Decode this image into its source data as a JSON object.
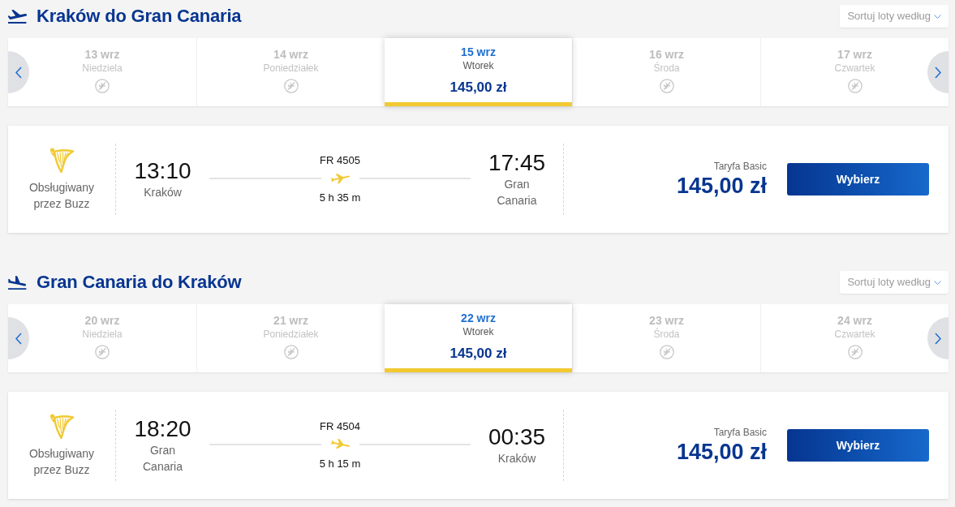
{
  "sections": [
    {
      "kind": "outbound",
      "title": "Kraków do Gran Canaria",
      "sort": {
        "label": "Sortuj loty według"
      },
      "dates": [
        {
          "date": "13 wrz",
          "weekday": "Niedziela",
          "selected": false
        },
        {
          "date": "14 wrz",
          "weekday": "Poniedziałek",
          "selected": false
        },
        {
          "date": "15 wrz",
          "weekday": "Wtorek",
          "price": "145,00 zł",
          "selected": true
        },
        {
          "date": "16 wrz",
          "weekday": "Środa",
          "selected": false
        },
        {
          "date": "17 wrz",
          "weekday": "Czwartek",
          "selected": false
        }
      ],
      "flights": [
        {
          "operator": "Obsługiwany przez Buzz",
          "departure_time": "13:10",
          "departure_city": "Kraków",
          "flight_number": "FR 4505",
          "duration": "5 h 35 m",
          "arrival_time": "17:45",
          "arrival_city": "Gran Canaria",
          "fare": "Taryfa Basic",
          "price": "145,00 zł",
          "button": "Wybierz"
        }
      ]
    },
    {
      "kind": "inbound",
      "title": "Gran Canaria do Kraków",
      "sort": {
        "label": "Sortuj loty według"
      },
      "dates": [
        {
          "date": "20 wrz",
          "weekday": "Niedziela",
          "selected": false
        },
        {
          "date": "21 wrz",
          "weekday": "Poniedziałek",
          "selected": false
        },
        {
          "date": "22 wrz",
          "weekday": "Wtorek",
          "price": "145,00 zł",
          "selected": true
        },
        {
          "date": "23 wrz",
          "weekday": "Środa",
          "selected": false
        },
        {
          "date": "24 wrz",
          "weekday": "Czwartek",
          "selected": false
        }
      ],
      "flights": [
        {
          "operator": "Obsługiwany przez Buzz",
          "departure_time": "18:20",
          "departure_city": "Gran Canaria",
          "flight_number": "FR 4504",
          "duration": "5 h 15 m",
          "arrival_time": "00:35",
          "arrival_city": "Kraków",
          "fare": "Taryfa Basic",
          "price": "145,00 zł",
          "button": "Wybierz"
        }
      ]
    }
  ]
}
